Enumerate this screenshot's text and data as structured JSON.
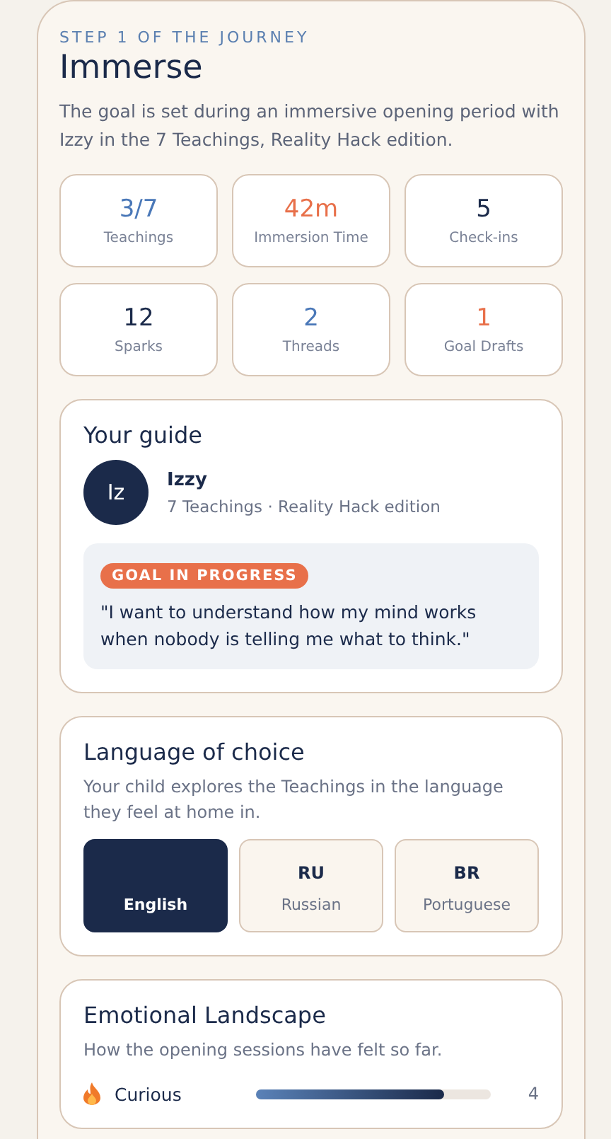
{
  "step_label": "STEP 1 OF THE JOURNEY",
  "title": "Immerse",
  "description": "The goal is set during an immersive opening period with Izzy in the 7 Teachings, Reality Hack edition.",
  "stats": [
    {
      "value": "3/7",
      "label": "Teachings",
      "color": "#4a78b8"
    },
    {
      "value": "42m",
      "label": "Immersion Time",
      "color": "#e8704a"
    },
    {
      "value": "5",
      "label": "Check-ins",
      "color": "#1b2a4a"
    },
    {
      "value": "12",
      "label": "Sparks",
      "color": "#1b2a4a"
    },
    {
      "value": "2",
      "label": "Threads",
      "color": "#4a78b8"
    },
    {
      "value": "1",
      "label": "Goal Drafts",
      "color": "#e8704a"
    }
  ],
  "guide": {
    "heading": "Your guide",
    "initials": "Iz",
    "name": "Izzy",
    "subtitle": "7 Teachings · Reality Hack edition",
    "goal_badge": "GOAL IN PROGRESS",
    "goal_quote": "\"I want to understand how my mind works when nobody is telling me what to think.\""
  },
  "language": {
    "heading": "Language of choice",
    "description": "Your child explores the Teachings in the language they feel at home in.",
    "options": [
      {
        "name": "English",
        "selected": true
      },
      {
        "code": "RU",
        "name": "Russian",
        "selected": false
      },
      {
        "code": "BR",
        "name": "Portuguese",
        "selected": false
      }
    ]
  },
  "emotions": {
    "heading": "Emotional Landscape",
    "description": "How the opening sessions have felt so far.",
    "items": [
      {
        "label": "Curious",
        "level": 0.8,
        "count": "4"
      }
    ]
  }
}
